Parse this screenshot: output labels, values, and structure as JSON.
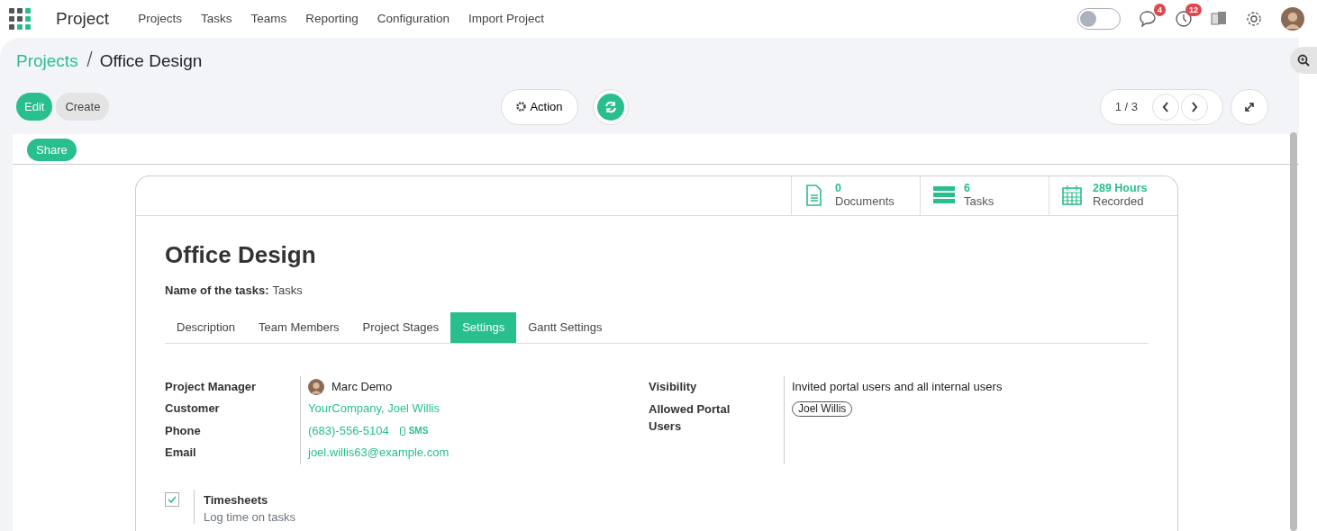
{
  "app": {
    "name": "Project",
    "menu": [
      "Projects",
      "Tasks",
      "Teams",
      "Reporting",
      "Configuration",
      "Import Project"
    ]
  },
  "systray": {
    "toggle": {
      "on": false
    },
    "badges": [
      {
        "kind": "chat",
        "count": "4"
      },
      {
        "kind": "clock",
        "count": "12"
      }
    ]
  },
  "breadcrumb": {
    "parent": "Projects",
    "current": "Office Design"
  },
  "buttons": {
    "edit": "Edit",
    "create": "Create",
    "action": "Action",
    "share": "Share"
  },
  "pager": {
    "value": "1 / 3"
  },
  "stats": [
    {
      "kind": "documents",
      "value": "0",
      "label": "Documents"
    },
    {
      "kind": "tasks",
      "value": "6",
      "label": "Tasks"
    },
    {
      "kind": "hours",
      "value": "289 Hours",
      "label": "Recorded"
    }
  ],
  "title": "Office Design",
  "tasks_name": {
    "label": "Name of the tasks:",
    "value": "Tasks"
  },
  "tabs": [
    {
      "label": "Description",
      "selected": false
    },
    {
      "label": "Team Members",
      "selected": false
    },
    {
      "label": "Project Stages",
      "selected": false
    },
    {
      "label": "Settings",
      "selected": true
    },
    {
      "label": "Gantt Settings",
      "selected": false
    }
  ],
  "left_fields": [
    {
      "label": "Project Manager",
      "value": "Marc Demo",
      "kind": "user"
    },
    {
      "label": "Customer",
      "value": "YourCompany, Joel Willis",
      "kind": "link"
    },
    {
      "label": "Phone",
      "value": "(683)-556-5104",
      "kind": "phone",
      "action": "SMS"
    },
    {
      "label": "Email",
      "value": "joel.willis63@example.com",
      "kind": "link"
    }
  ],
  "right_fields": [
    {
      "label": "Visibility",
      "value": "Invited portal users and all internal users",
      "kind": "text"
    },
    {
      "label": "Allowed Portal Users",
      "tags": [
        "Joel Willis"
      ],
      "kind": "tags"
    }
  ],
  "settings": [
    {
      "label": "Timesheets",
      "description": "Log time on tasks",
      "checked": true
    }
  ]
}
